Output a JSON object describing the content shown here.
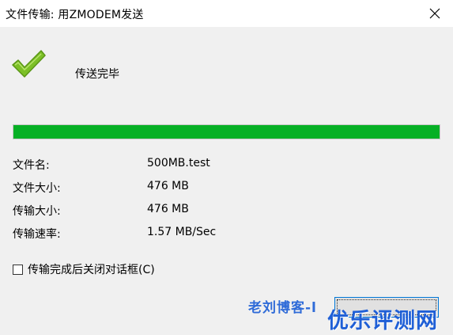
{
  "window": {
    "title": "文件传输: 用ZMODEM发送",
    "close_icon": "close-icon"
  },
  "status": {
    "icon": "checkmark-icon",
    "text": "传送完毕",
    "icon_color": "#6fb31e"
  },
  "progress": {
    "fraction": 1.0,
    "color": "#06b025"
  },
  "details": {
    "filename": {
      "label": "文件名:",
      "value": "500MB.test"
    },
    "filesize": {
      "label": "文件大小:",
      "value": "476 MB"
    },
    "transferred": {
      "label": "传输大小:",
      "value": "476 MB"
    },
    "speed": {
      "label": "传输速率:",
      "value": "1.57 MB/Sec"
    }
  },
  "options": {
    "close_on_complete_label": "传输完成后关闭对话框(C)",
    "close_on_complete_checked": false
  },
  "watermark": {
    "text1": "老刘博客-l",
    "text2": "优乐评测网"
  }
}
